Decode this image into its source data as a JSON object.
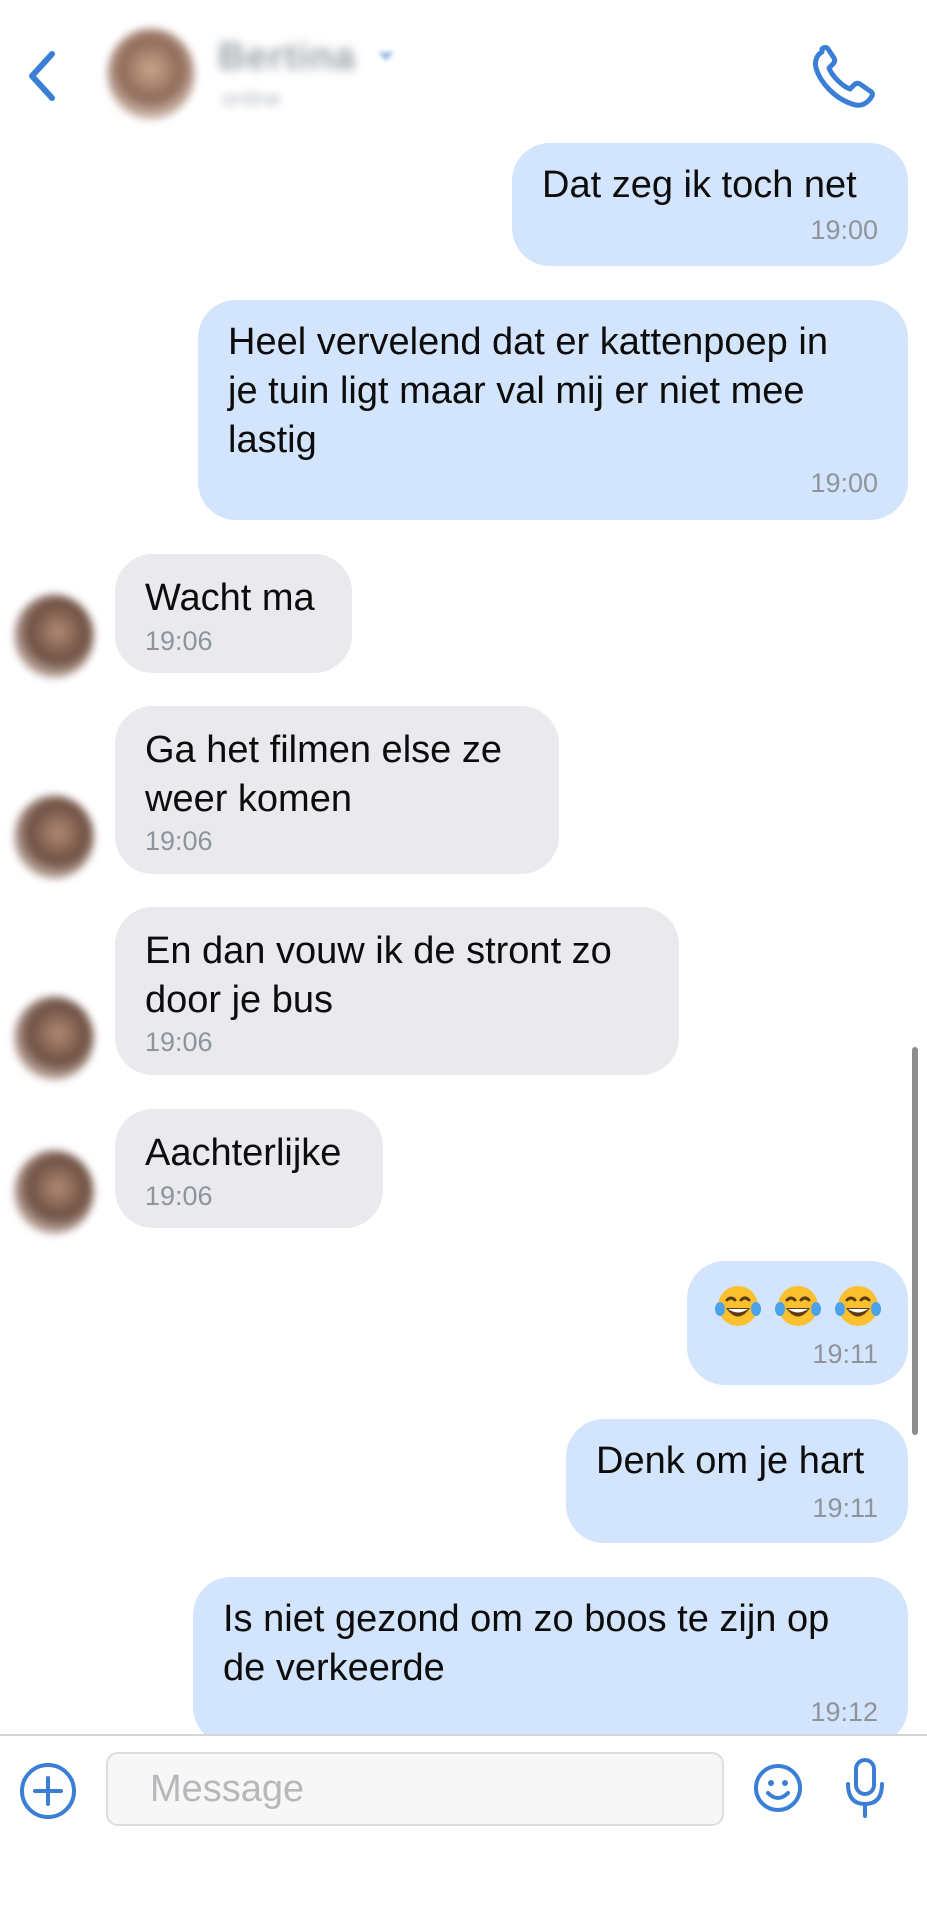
{
  "header": {
    "contact_name": "Bertina",
    "status": "online",
    "accent_color": "#3a7fd5",
    "icons": [
      "back-icon",
      "avatar",
      "phone-icon"
    ]
  },
  "messages": [
    {
      "direction": "outgoing",
      "text": "Dat zeg ik toch net",
      "time": "19:00"
    },
    {
      "direction": "outgoing",
      "text": "Heel vervelend dat er kattenpoep in\nje tuin ligt maar val mij er niet mee\nlastig",
      "time": "19:00"
    },
    {
      "direction": "incoming",
      "text": "Wacht ma",
      "time": "19:06"
    },
    {
      "direction": "incoming",
      "text": "Ga het filmen else ze\nweer komen",
      "time": "19:06"
    },
    {
      "direction": "incoming",
      "text": "En dan vouw ik de stront zo\ndoor je bus",
      "time": "19:06"
    },
    {
      "direction": "incoming",
      "text": "Aachterlijke",
      "time": "19:06"
    },
    {
      "direction": "outgoing",
      "emoji": [
        "face-with-tears-of-joy",
        "face-with-tears-of-joy",
        "face-with-tears-of-joy"
      ],
      "time": "19:11"
    },
    {
      "direction": "outgoing",
      "text": "Denk om je hart",
      "time": "19:11"
    },
    {
      "direction": "outgoing",
      "text": "Is niet gezond om zo boos te zijn op\nde verkeerde",
      "time": "19:12"
    }
  ],
  "composer": {
    "placeholder": "Message",
    "value": "",
    "icons": [
      "plus-icon",
      "emoji-icon",
      "microphone-icon"
    ]
  },
  "colors": {
    "outgoing_bubble": "#d3e5fc",
    "incoming_bubble": "#e9e9ee",
    "timestamp": "#8e949c"
  }
}
